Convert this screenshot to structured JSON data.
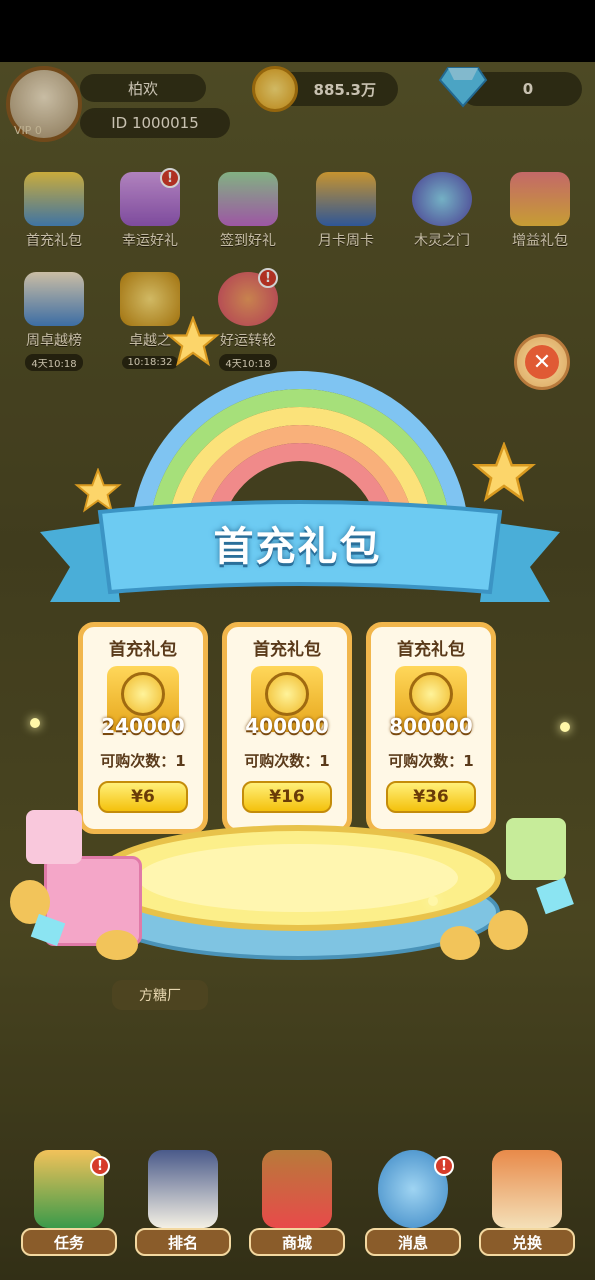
{
  "profile": {
    "name": "柏欢",
    "id_text": "ID 1000015",
    "vip_text": "VIP 0"
  },
  "resources": {
    "coins": "885.3万",
    "gems": "0"
  },
  "menu": [
    {
      "label": "首充礼包",
      "icon": "gift-box-icon",
      "badge": ""
    },
    {
      "label": "幸运好礼",
      "icon": "lucky-gift-icon",
      "badge": "!"
    },
    {
      "label": "签到好礼",
      "icon": "sign-in-gift-icon",
      "badge": ""
    },
    {
      "label": "月卡周卡",
      "icon": "card-icon",
      "badge": ""
    },
    {
      "label": "木灵之门",
      "icon": "portal-icon",
      "badge": ""
    },
    {
      "label": "增益礼包",
      "icon": "boost-gift-icon",
      "badge": ""
    },
    {
      "label": "周卓越榜",
      "icon": "calendar-icon",
      "badge": "",
      "timer": "4天10:18"
    },
    {
      "label": "卓越之",
      "icon": "trophy-icon",
      "badge": "",
      "timer": "10:18:32"
    },
    {
      "label": "好运转轮",
      "icon": "wheel-icon",
      "badge": "!",
      "timer": "4天10:18"
    }
  ],
  "popup": {
    "title": "首充礼包",
    "close_icon": "close-icon",
    "cards": [
      {
        "title": "首充礼包",
        "amount": "240000",
        "count_label": "可购次数：1",
        "price": "¥6"
      },
      {
        "title": "首充礼包",
        "amount": "400000",
        "count_label": "可购次数：1",
        "price": "¥16"
      },
      {
        "title": "首充礼包",
        "amount": "800000",
        "count_label": "可购次数：1",
        "price": "¥36"
      }
    ]
  },
  "place_label": "方糖厂",
  "bottom_nav": [
    {
      "label": "任务",
      "icon": "fast-forward-icon",
      "badge": "!"
    },
    {
      "label": "排名",
      "icon": "calendar-check-icon",
      "badge": ""
    },
    {
      "label": "商城",
      "icon": "shop-icon",
      "badge": ""
    },
    {
      "label": "消息",
      "icon": "balloon-icon",
      "badge": "!"
    },
    {
      "label": "兑换",
      "icon": "house-icon",
      "badge": ""
    }
  ],
  "colors": {
    "accent_gold": "#f1b64c",
    "ribbon_blue": "#5ec0ea",
    "badge_red": "#d63b2a"
  }
}
